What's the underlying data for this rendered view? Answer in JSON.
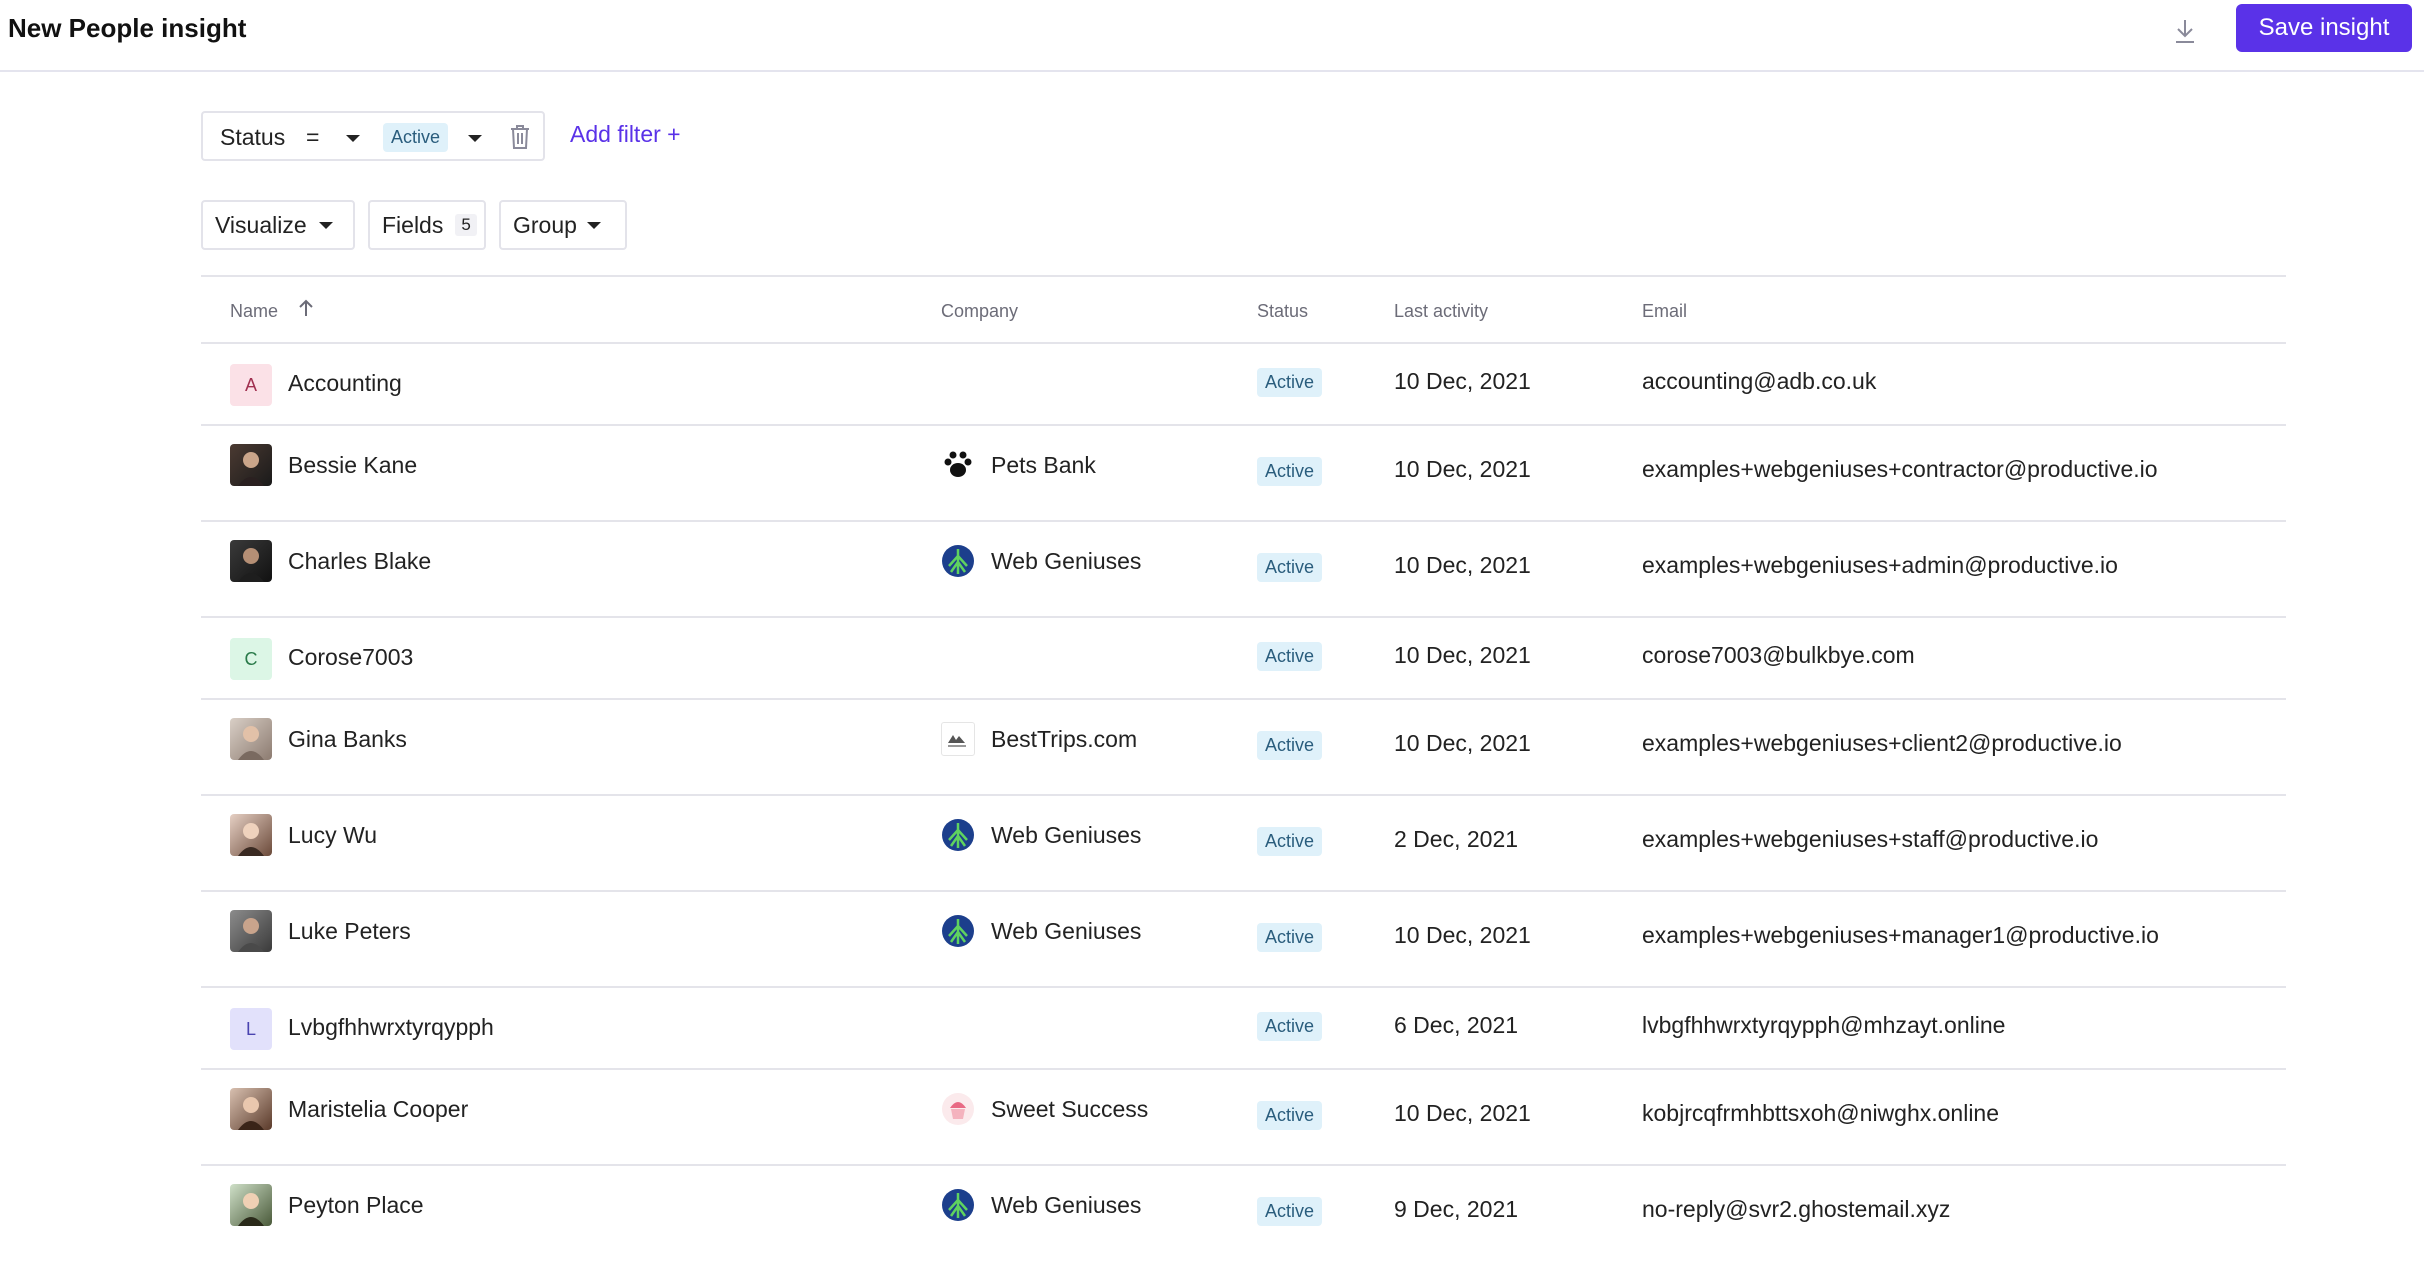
{
  "header": {
    "title": "New People insight",
    "save_label": "Save insight",
    "download_icon": "download-icon"
  },
  "filter": {
    "field": "Status",
    "operator": "=",
    "value": "Active",
    "add_label": "Add filter +"
  },
  "controls": {
    "visualize": "Visualize",
    "fields": "Fields",
    "fields_count": "5",
    "group": "Group"
  },
  "table": {
    "columns": [
      "Name",
      "Company",
      "Status",
      "Last activity",
      "Email"
    ],
    "rows": [
      {
        "initial": "A",
        "name": "Accounting",
        "company": "",
        "status": "Active",
        "last_activity": "10 Dec, 2021",
        "email": "accounting@adb.co.uk"
      },
      {
        "initial": "",
        "name": "Bessie Kane",
        "company": "Pets Bank",
        "status": "Active",
        "last_activity": "10 Dec, 2021",
        "email": "examples+webgeniuses+contractor@productive.io"
      },
      {
        "initial": "",
        "name": "Charles Blake",
        "company": "Web Geniuses",
        "status": "Active",
        "last_activity": "10 Dec, 2021",
        "email": "examples+webgeniuses+admin@productive.io"
      },
      {
        "initial": "C",
        "name": "Corose7003",
        "company": "",
        "status": "Active",
        "last_activity": "10 Dec, 2021",
        "email": "corose7003@bulkbye.com"
      },
      {
        "initial": "",
        "name": "Gina Banks",
        "company": "BestTrips.com",
        "status": "Active",
        "last_activity": "10 Dec, 2021",
        "email": "examples+webgeniuses+client2@productive.io"
      },
      {
        "initial": "",
        "name": "Lucy Wu",
        "company": "Web Geniuses",
        "status": "Active",
        "last_activity": "2 Dec, 2021",
        "email": "examples+webgeniuses+staff@productive.io"
      },
      {
        "initial": "",
        "name": "Luke Peters",
        "company": "Web Geniuses",
        "status": "Active",
        "last_activity": "10 Dec, 2021",
        "email": "examples+webgeniuses+manager1@productive.io"
      },
      {
        "initial": "L",
        "name": "Lvbgfhhwrxtyrqypph",
        "company": "",
        "status": "Active",
        "last_activity": "6 Dec, 2021",
        "email": "lvbgfhhwrxtyrqypph@mhzayt.online"
      },
      {
        "initial": "",
        "name": "Maristelia Cooper",
        "company": "Sweet Success",
        "status": "Active",
        "last_activity": "10 Dec, 2021",
        "email": "kobjrcqfrmhbttsxoh@niwghx.online"
      },
      {
        "initial": "",
        "name": "Peyton Place",
        "company": "Web Geniuses",
        "status": "Active",
        "last_activity": "9 Dec, 2021",
        "email": "no-reply@svr2.ghostemail.xyz"
      }
    ]
  },
  "colors": {
    "accent": "#5a32e8",
    "status_bg": "#dff1fa",
    "status_text": "#2a5d7d"
  }
}
